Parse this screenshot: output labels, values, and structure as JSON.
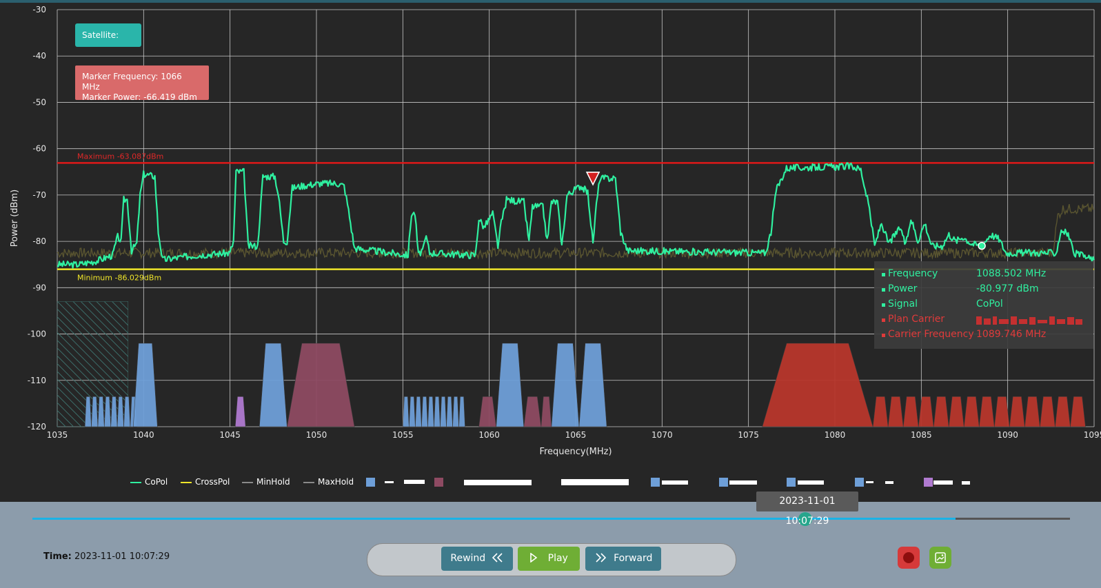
{
  "chart_data": {
    "type": "line",
    "xlabel": "Frequency(MHz)",
    "ylabel": "Power (dBm)",
    "xlim": [
      1035,
      1095
    ],
    "ylim": [
      -120,
      -30
    ],
    "x_ticks": [
      "1035",
      "1040",
      "1045",
      "1050",
      "1055",
      "1060",
      "1065",
      "1070",
      "1075",
      "1080",
      "1085",
      "1090",
      "1095"
    ],
    "y_ticks": [
      "-30",
      "-40",
      "-50",
      "-60",
      "-70",
      "-80",
      "-90",
      "-100",
      "-110",
      "-120"
    ],
    "grid": true,
    "noise_floor_dbm": -82.5,
    "series": [
      {
        "name": "CoPol",
        "color": "#2ff0a0",
        "values": [
          {
            "x": 1035,
            "y": -85
          },
          {
            "x": 1036.2,
            "y": -85
          },
          {
            "x": 1037.3,
            "y": -84.2
          },
          {
            "x": 1038.2,
            "y": -83
          },
          {
            "x": 1038.5,
            "y": -79
          },
          {
            "x": 1038.7,
            "y": -80
          },
          {
            "x": 1038.85,
            "y": -71
          },
          {
            "x": 1039.05,
            "y": -71
          },
          {
            "x": 1039.3,
            "y": -82
          },
          {
            "x": 1039.6,
            "y": -80.5
          },
          {
            "x": 1039.8,
            "y": -70
          },
          {
            "x": 1040,
            "y": -65.5
          },
          {
            "x": 1040.4,
            "y": -65.8
          },
          {
            "x": 1040.65,
            "y": -66
          },
          {
            "x": 1040.85,
            "y": -78
          },
          {
            "x": 1041.1,
            "y": -84
          },
          {
            "x": 1043,
            "y": -83
          },
          {
            "x": 1045,
            "y": -82.5
          },
          {
            "x": 1045.2,
            "y": -80
          },
          {
            "x": 1045.35,
            "y": -65
          },
          {
            "x": 1045.8,
            "y": -65
          },
          {
            "x": 1046.05,
            "y": -81
          },
          {
            "x": 1046.6,
            "y": -81
          },
          {
            "x": 1046.9,
            "y": -66
          },
          {
            "x": 1047.6,
            "y": -66
          },
          {
            "x": 1047.8,
            "y": -70
          },
          {
            "x": 1048.1,
            "y": -80
          },
          {
            "x": 1048.3,
            "y": -80
          },
          {
            "x": 1048.6,
            "y": -68.5
          },
          {
            "x": 1049.2,
            "y": -68
          },
          {
            "x": 1050.2,
            "y": -67.5
          },
          {
            "x": 1051.2,
            "y": -67.5
          },
          {
            "x": 1051.6,
            "y": -68
          },
          {
            "x": 1051.8,
            "y": -72
          },
          {
            "x": 1052.2,
            "y": -81.5
          },
          {
            "x": 1055.3,
            "y": -83
          },
          {
            "x": 1055.5,
            "y": -74
          },
          {
            "x": 1055.7,
            "y": -74
          },
          {
            "x": 1055.9,
            "y": -83
          },
          {
            "x": 1056.2,
            "y": -81.5
          },
          {
            "x": 1056.35,
            "y": -79
          },
          {
            "x": 1056.55,
            "y": -82.5
          },
          {
            "x": 1059.2,
            "y": -83
          },
          {
            "x": 1059.4,
            "y": -75
          },
          {
            "x": 1059.7,
            "y": -77
          },
          {
            "x": 1060.2,
            "y": -74
          },
          {
            "x": 1060.5,
            "y": -81
          },
          {
            "x": 1060.7,
            "y": -76
          },
          {
            "x": 1061,
            "y": -71
          },
          {
            "x": 1062,
            "y": -71.5
          },
          {
            "x": 1062.3,
            "y": -80
          },
          {
            "x": 1062.5,
            "y": -72.5
          },
          {
            "x": 1063.1,
            "y": -72.5
          },
          {
            "x": 1063.35,
            "y": -80
          },
          {
            "x": 1063.6,
            "y": -71.5
          },
          {
            "x": 1063.95,
            "y": -71.5
          },
          {
            "x": 1064.2,
            "y": -81
          },
          {
            "x": 1064.5,
            "y": -70
          },
          {
            "x": 1065.3,
            "y": -68
          },
          {
            "x": 1065.7,
            "y": -69.5
          },
          {
            "x": 1066,
            "y": -80.5
          },
          {
            "x": 1066.2,
            "y": -72
          },
          {
            "x": 1066.4,
            "y": -66.4
          },
          {
            "x": 1067.3,
            "y": -66.4
          },
          {
            "x": 1067.6,
            "y": -78
          },
          {
            "x": 1068,
            "y": -82
          },
          {
            "x": 1076,
            "y": -82.5
          },
          {
            "x": 1076.3,
            "y": -78
          },
          {
            "x": 1076.6,
            "y": -69
          },
          {
            "x": 1077.2,
            "y": -64.2
          },
          {
            "x": 1081,
            "y": -63.8
          },
          {
            "x": 1081.5,
            "y": -64.5
          },
          {
            "x": 1082,
            "y": -73
          },
          {
            "x": 1082.3,
            "y": -81
          },
          {
            "x": 1082.7,
            "y": -76
          },
          {
            "x": 1083.1,
            "y": -80.5
          },
          {
            "x": 1083.4,
            "y": -79
          },
          {
            "x": 1083.8,
            "y": -77
          },
          {
            "x": 1084.1,
            "y": -81
          },
          {
            "x": 1084.4,
            "y": -75
          },
          {
            "x": 1084.8,
            "y": -80
          },
          {
            "x": 1085.2,
            "y": -76
          },
          {
            "x": 1085.6,
            "y": -81
          },
          {
            "x": 1086.2,
            "y": -81
          },
          {
            "x": 1086.6,
            "y": -78.5
          },
          {
            "x": 1087,
            "y": -80
          },
          {
            "x": 1087.4,
            "y": -79
          },
          {
            "x": 1087.9,
            "y": -80.5
          },
          {
            "x": 1088.5,
            "y": -81
          },
          {
            "x": 1089,
            "y": -78.5
          },
          {
            "x": 1089.5,
            "y": -79.5
          },
          {
            "x": 1089.9,
            "y": -82.5
          },
          {
            "x": 1092.8,
            "y": -82.5
          },
          {
            "x": 1093.1,
            "y": -77.5
          },
          {
            "x": 1093.5,
            "y": -78.5
          },
          {
            "x": 1093.8,
            "y": -82.5
          },
          {
            "x": 1095,
            "y": -84
          }
        ]
      },
      {
        "name": "MaxHold",
        "color": "#5a5530",
        "values": [
          {
            "x": 1035,
            "y": -82.5
          },
          {
            "x": 1092.6,
            "y": -82.5
          },
          {
            "x": 1092.9,
            "y": -74.5
          },
          {
            "x": 1093.2,
            "y": -73
          },
          {
            "x": 1095,
            "y": -73
          }
        ]
      }
    ],
    "reference_lines": {
      "maximum_dbm": -63.087,
      "maximum_label": "Maximum -63.087dBm",
      "minimum_dbm": -86.029,
      "minimum_label": "Minimum -86.029dBm"
    },
    "marker": {
      "x": 1066,
      "y": -66.419
    },
    "hover_point": {
      "x": 1088.502,
      "y": -80.977
    },
    "plan_carriers": [
      {
        "type": "blue",
        "x_start": 1036.6,
        "x_end": 1039.6,
        "top_dbm": -113.5,
        "count": 8
      },
      {
        "type": "blue",
        "x_start": 1039.4,
        "x_end": 1040.8,
        "top_dbm": -102
      },
      {
        "type": "purple",
        "x_start": 1045.3,
        "x_end": 1045.9,
        "top_dbm": -113.5
      },
      {
        "type": "blue",
        "x_start": 1046.7,
        "x_end": 1048.3,
        "top_dbm": -102
      },
      {
        "type": "maroon",
        "x_start": 1048.3,
        "x_end": 1052.2,
        "top_dbm": -102
      },
      {
        "type": "blue",
        "x_start": 1055,
        "x_end": 1058.6,
        "top_dbm": -113.5,
        "count": 10
      },
      {
        "type": "maroon",
        "x_start": 1059.4,
        "x_end": 1060.4,
        "top_dbm": -113.5
      },
      {
        "type": "blue",
        "x_start": 1060.4,
        "x_end": 1062,
        "top_dbm": -102
      },
      {
        "type": "maroon",
        "x_start": 1062,
        "x_end": 1063,
        "top_dbm": -113.5
      },
      {
        "type": "maroon",
        "x_start": 1063,
        "x_end": 1063.6,
        "top_dbm": -113.5
      },
      {
        "type": "blue",
        "x_start": 1063.6,
        "x_end": 1065.2,
        "top_dbm": -102
      },
      {
        "type": "blue",
        "x_start": 1065.2,
        "x_end": 1066.8,
        "top_dbm": -102
      },
      {
        "type": "red",
        "x_start": 1075.8,
        "x_end": 1082.2,
        "top_dbm": -102
      },
      {
        "type": "red",
        "x_start": 1082.2,
        "x_end": 1094.5,
        "top_dbm": -113.5,
        "count": 14
      }
    ],
    "legend": [
      "CoPol",
      "CrossPol",
      "MinHold",
      "MaxHold"
    ]
  },
  "satellite_label": "Satellite:",
  "marker_box": {
    "frequency_line": "Marker Frequency: 1066 MHz",
    "power_line": "Marker Power: -66.419 dBm"
  },
  "tooltip": {
    "rows": [
      {
        "key": "Frequency",
        "value": "1088.502 MHz",
        "color": "#2ff0a0"
      },
      {
        "key": "Power",
        "value": "-80.977 dBm",
        "color": "#2ff0a0"
      },
      {
        "key": "Signal",
        "value": "CoPol",
        "color": "#2ff0a0"
      },
      {
        "key": "Plan Carrier",
        "value": "",
        "color": "#e03a3a"
      },
      {
        "key": "Carrier Frequency",
        "value": "1089.746 MHz",
        "color": "#e03a3a"
      }
    ]
  },
  "legend_labels": {
    "copol": "CoPol",
    "crosspol": "CrossPol",
    "minhold": "MinHold",
    "maxhold": "MaxHold"
  },
  "colors": {
    "copol": "#2ff0a0",
    "crosspol": "#f0e62a",
    "minhold": "#8a8a8a",
    "maxhold": "#8a8a8a",
    "max_line": "#e01818",
    "min_line": "#f0e62a",
    "carrier_blue": "#6e9fd8",
    "carrier_maroon": "#8e4a62",
    "carrier_red": "#b8362c",
    "carrier_purple": "#b07ad0"
  },
  "playback": {
    "time_bubble": "2023-11-01 10:07:29",
    "time_label": "Time:",
    "time_value": "2023-11-01 10:07:29",
    "progress_fraction": 0.745,
    "buffered_fraction": 0.89,
    "rewind_label": "Rewind",
    "play_label": "Play",
    "forward_label": "Forward"
  }
}
